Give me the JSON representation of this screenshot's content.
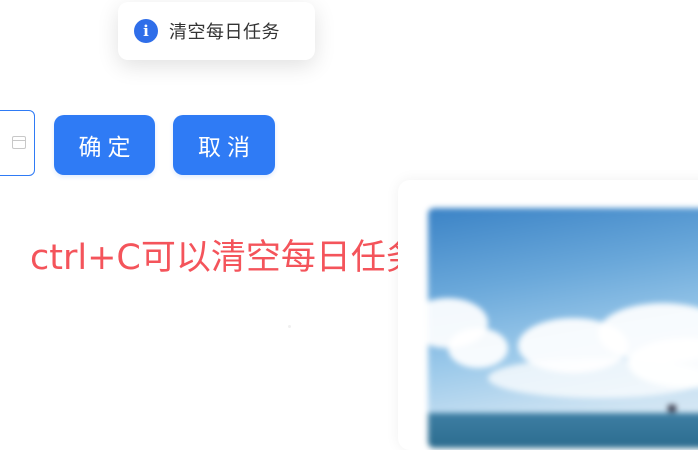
{
  "toast": {
    "icon": "info-icon",
    "icon_glyph": "i",
    "message": "清空每日任务"
  },
  "date_input": {
    "icon": "calendar-icon"
  },
  "buttons": {
    "confirm_label": "确定",
    "cancel_label": "取消"
  },
  "hint": {
    "text": "ctrl+C可以清空每日任务"
  },
  "image": {
    "description_icon": "sky-photo"
  },
  "colors": {
    "accent": "#2f7bf5",
    "hint_red": "#f4545b",
    "info_blue": "#2f6ee9"
  }
}
